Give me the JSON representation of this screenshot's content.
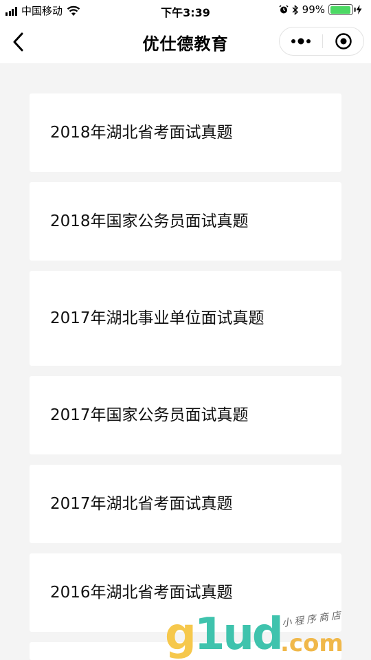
{
  "status_bar": {
    "carrier": "中国移动",
    "time": "下午3:39",
    "battery_percent": "99%",
    "battery_level": 0.99,
    "icons": [
      "signal-icon",
      "wifi-icon",
      "alarm-icon",
      "bluetooth-icon",
      "battery-icon",
      "charging-icon"
    ]
  },
  "nav": {
    "title": "优仕德教育",
    "icons": [
      "back-chevron-icon",
      "more-dots-icon",
      "close-target-icon"
    ]
  },
  "list": {
    "items": [
      {
        "label": "2018年湖北省考面试真题"
      },
      {
        "label": "2018年国家公务员面试真题"
      },
      {
        "label": "2017年湖北事业单位面试真题"
      },
      {
        "label": "2017年国家公务员面试真题"
      },
      {
        "label": "2017年湖北省考面试真题"
      },
      {
        "label": "2016年湖北省考面试真题"
      }
    ]
  },
  "watermark": {
    "brand_g": "g",
    "brand_rest": "1ud",
    "dotcom": ".com",
    "tagline": "小程序商店"
  }
}
